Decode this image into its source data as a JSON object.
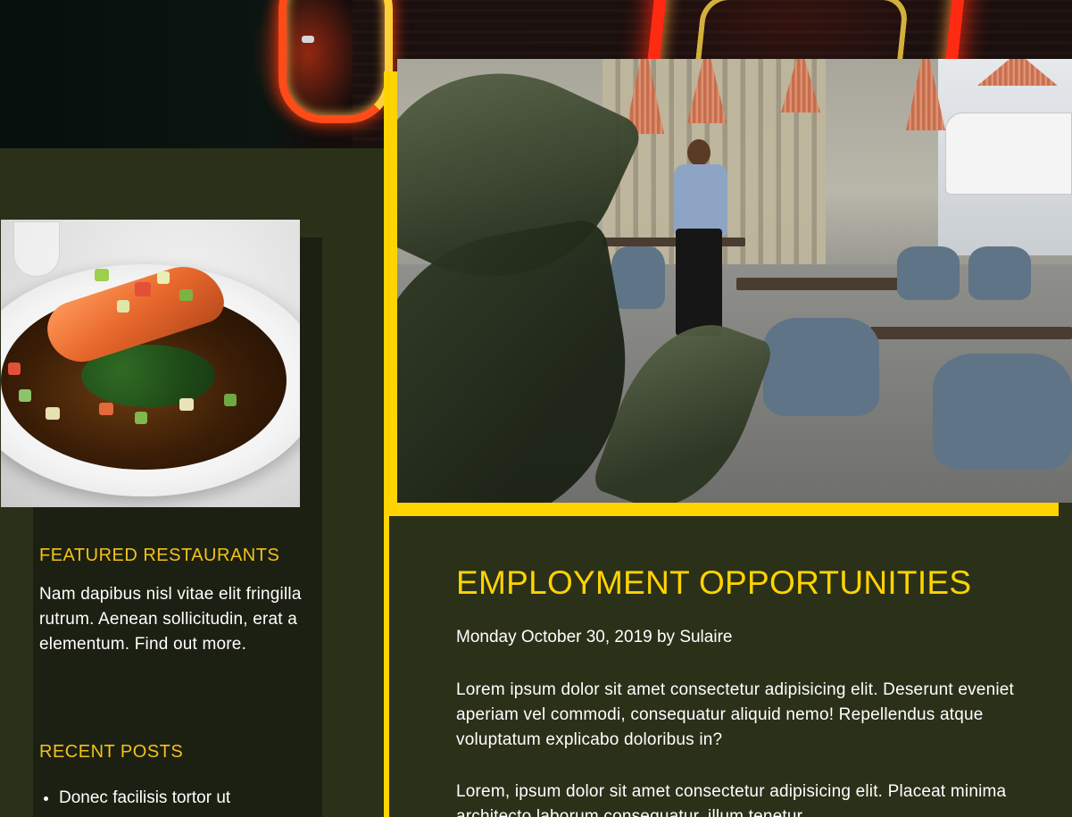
{
  "sidebar": {
    "featured_heading": "FEATURED RESTAURANTS",
    "featured_text": "Nam dapibus nisl vitae elit fringilla rutrum. Aenean sollicitudin, erat a elementum.",
    "featured_link": "Find out more.",
    "recent_heading": "RECENT POSTS",
    "recent_posts": [
      "Donec facilisis tortor ut"
    ]
  },
  "article": {
    "title": "EMPLOYMENT OPPORTUNITIES",
    "meta": "Monday October 30, 2019 by Sulaire",
    "paragraphs": [
      "Lorem ipsum dolor sit amet consectetur adipisicing elit. Deserunt eveniet aperiam vel commodi, consequatur aliquid nemo! Repellendus atque voluptatum explicabo doloribus in?",
      "Lorem, ipsum dolor sit amet consectetur adipisicing elit. Placeat minima architecto laborum consequatur, illum tenetur"
    ]
  },
  "colors": {
    "background": "#2b3019",
    "sidebar_panel": "#1c2012",
    "accent_yellow": "#ffd400",
    "heading_yellow": "#f2c21b",
    "text": "#ffffff"
  },
  "images": {
    "hero": "neon-sign-photo",
    "sidebar": "salmon-dish-photo",
    "article": "restaurant-interior-photo"
  }
}
